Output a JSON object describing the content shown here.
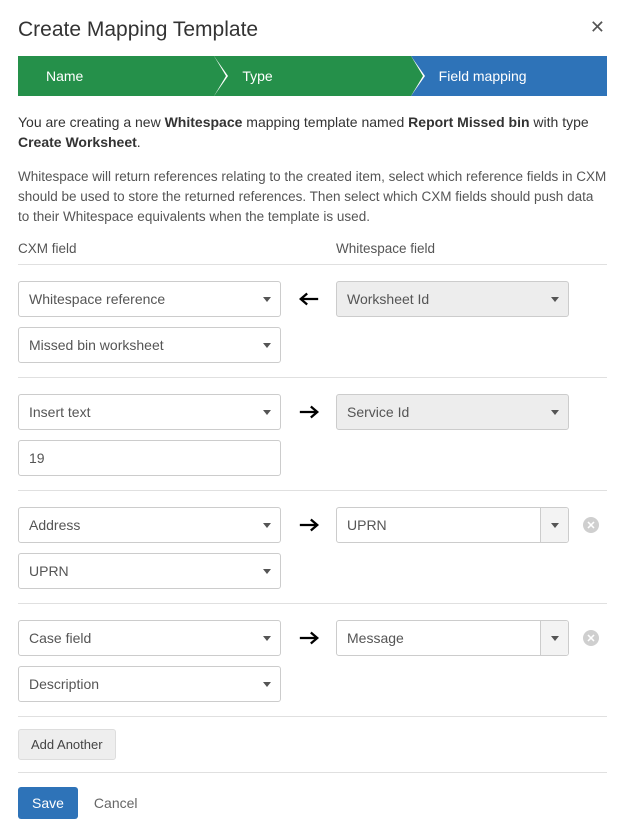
{
  "title": "Create Mapping Template",
  "steps": {
    "s1": "Name",
    "s2": "Type",
    "s3": "Field mapping"
  },
  "intro": {
    "pre": "You are creating a new ",
    "brand": "Whitespace",
    "mid": " mapping template named ",
    "name": "Report Missed bin",
    "with": " with type ",
    "type": "Create Worksheet",
    "end": "."
  },
  "desc": "Whitespace will return references relating to the created item, select which reference fields in CXM should be used to store the returned references. Then select which CXM fields should push data to their Whitespace equivalents when the template is used.",
  "cols": {
    "left": "CXM field",
    "right": "Whitespace field"
  },
  "rows": [
    {
      "direction": "left",
      "cxm_type": "Whitespace reference",
      "cxm_value": "Missed bin worksheet",
      "ws_field": "Worksheet Id",
      "removable": false,
      "value_is_select": true
    },
    {
      "direction": "right",
      "cxm_type": "Insert text",
      "cxm_value": "19",
      "ws_field": "Service Id",
      "removable": false,
      "value_is_select": false
    },
    {
      "direction": "right",
      "cxm_type": "Address",
      "cxm_value": "UPRN",
      "ws_field": "UPRN",
      "removable": true,
      "value_is_select": true
    },
    {
      "direction": "right",
      "cxm_type": "Case field",
      "cxm_value": "Description",
      "ws_field": "Message",
      "removable": true,
      "value_is_select": true
    }
  ],
  "addAnother": "Add Another",
  "save": "Save",
  "cancel": "Cancel"
}
